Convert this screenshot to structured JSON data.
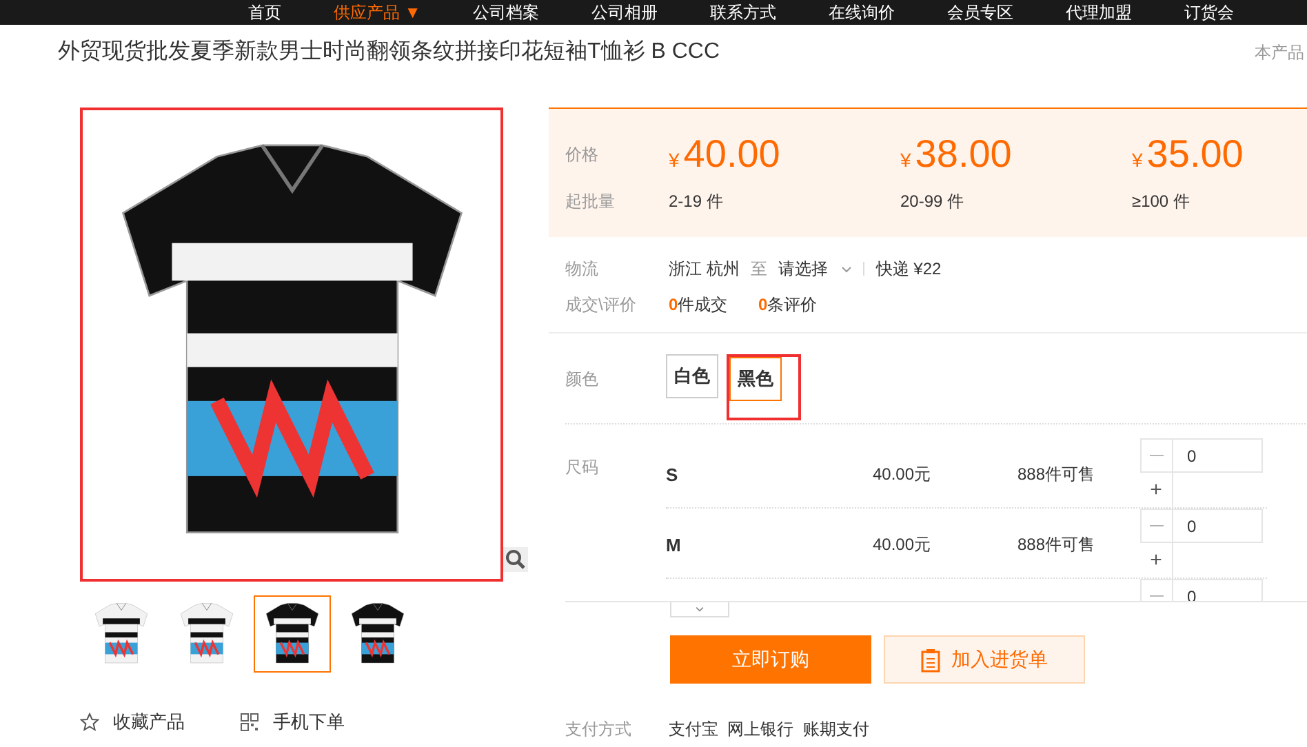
{
  "nav": [
    {
      "label": "首页",
      "selected": false
    },
    {
      "label": "供应产品",
      "selected": true,
      "caret": "▼"
    },
    {
      "label": "公司档案",
      "selected": false
    },
    {
      "label": "公司相册",
      "selected": false
    },
    {
      "label": "联系方式",
      "selected": false
    },
    {
      "label": "在线询价",
      "selected": false
    },
    {
      "label": "会员专区",
      "selected": false
    },
    {
      "label": "代理加盟",
      "selected": false
    },
    {
      "label": "订货会",
      "selected": false
    }
  ],
  "title": "外贸现货批发夏季新款男士时尚翻领条纹拼接印花短袖T恤衫 B CCC",
  "side_label": "本产品",
  "thumbnails": [
    {
      "kind": "white",
      "selected": false
    },
    {
      "kind": "white",
      "selected": false
    },
    {
      "kind": "black",
      "selected": true
    },
    {
      "kind": "black",
      "selected": false
    }
  ],
  "actions": [
    {
      "kind": "star",
      "label": "收藏产品"
    },
    {
      "kind": "qr",
      "label": "手机下单"
    }
  ],
  "price_label": "价格",
  "qty_label": "起批量",
  "tiers": [
    {
      "currency": "¥",
      "price": "40.00",
      "range": "2-19 件"
    },
    {
      "currency": "¥",
      "price": "38.00",
      "range": "20-99 件"
    },
    {
      "currency": "¥",
      "price": "35.00",
      "range": "≥100 件"
    }
  ],
  "logistics": {
    "label": "物流",
    "from": "浙江 杭州",
    "to": "至",
    "destination": "请选择",
    "shipping": "快递 ¥22"
  },
  "deals": {
    "label": "成交\\评价",
    "sold_count": "0",
    "sold": "件成交",
    "review_count": "0",
    "reviews": "条评价"
  },
  "color": {
    "label": "颜色",
    "options": [
      {
        "label": "白色",
        "selected": false
      },
      {
        "label": "黑色",
        "selected": true
      }
    ]
  },
  "size": {
    "label": "尺码",
    "rows": [
      {
        "name": "S",
        "price": "40.00元",
        "stock": "888件可售",
        "minus": "—",
        "qty": "0",
        "plus": "+"
      },
      {
        "name": "M",
        "price": "40.00元",
        "stock": "888件可售",
        "minus": "—",
        "qty": "0",
        "plus": "+"
      },
      {
        "minus": "—",
        "qty": "0"
      }
    ]
  },
  "buttons": {
    "order": "立即订购",
    "cart": "加入进货单"
  },
  "payment": {
    "label": "支付方式",
    "methods": "支付宝  网上银行  账期支付"
  }
}
